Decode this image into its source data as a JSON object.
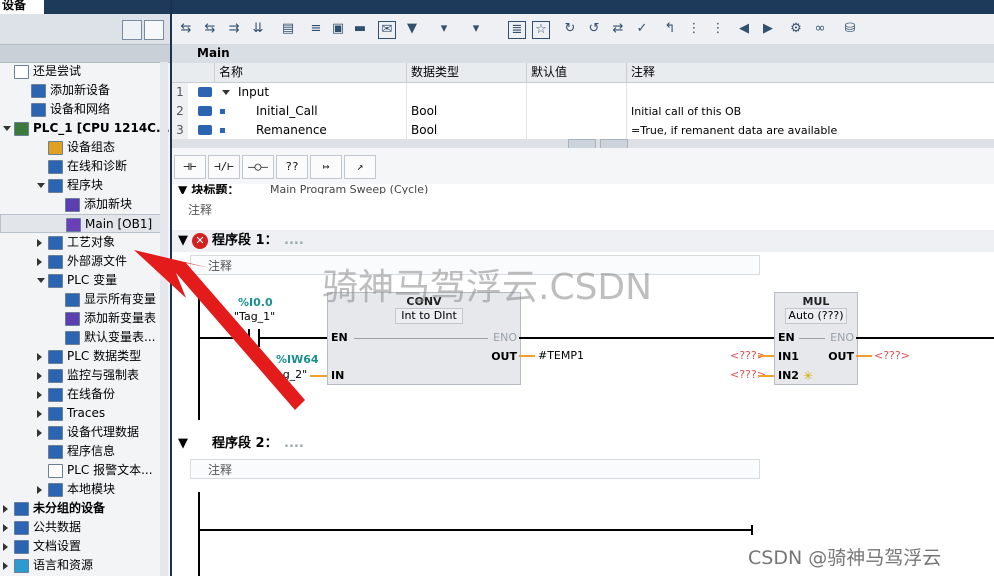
{
  "left_panel": {
    "title": "设备",
    "tree": [
      {
        "label": "还是尝试",
        "indent": 0,
        "arrow": "",
        "icon": "project-icon",
        "bold": false
      },
      {
        "label": "添加新设备",
        "indent": 1,
        "arrow": "",
        "icon": "add-device-icon",
        "bold": false
      },
      {
        "label": "设备和网络",
        "indent": 1,
        "arrow": "",
        "icon": "network-icon",
        "bold": false
      },
      {
        "label": "PLC_1 [CPU 1214C...",
        "indent": 0,
        "arrow": "down",
        "icon": "plc-icon",
        "bold": true
      },
      {
        "label": "设备组态",
        "indent": 2,
        "arrow": "",
        "icon": "device-config-icon",
        "bold": false
      },
      {
        "label": "在线和诊断",
        "indent": 2,
        "arrow": "",
        "icon": "diagnostics-icon",
        "bold": false
      },
      {
        "label": "程序块",
        "indent": 2,
        "arrow": "down",
        "icon": "folder-icon",
        "bold": false
      },
      {
        "label": "添加新块",
        "indent": 3,
        "arrow": "",
        "icon": "add-block-icon",
        "bold": false
      },
      {
        "label": "Main [OB1]",
        "indent": 3,
        "arrow": "",
        "icon": "ob-block-icon",
        "bold": false,
        "selected": true
      },
      {
        "label": "工艺对象",
        "indent": 2,
        "arrow": "right",
        "icon": "folder-icon",
        "bold": false
      },
      {
        "label": "外部源文件",
        "indent": 2,
        "arrow": "right",
        "icon": "folder-icon",
        "bold": false
      },
      {
        "label": "PLC 变量",
        "indent": 2,
        "arrow": "down",
        "icon": "folder-icon",
        "bold": false
      },
      {
        "label": "显示所有变量",
        "indent": 3,
        "arrow": "",
        "icon": "tag-table-icon",
        "bold": false
      },
      {
        "label": "添加新变量表",
        "indent": 3,
        "arrow": "",
        "icon": "add-tag-table-icon",
        "bold": false
      },
      {
        "label": "默认变量表...",
        "indent": 3,
        "arrow": "",
        "icon": "tag-table-icon",
        "bold": false
      },
      {
        "label": "PLC 数据类型",
        "indent": 2,
        "arrow": "right",
        "icon": "folder-icon",
        "bold": false
      },
      {
        "label": "监控与强制表",
        "indent": 2,
        "arrow": "right",
        "icon": "folder-icon",
        "bold": false
      },
      {
        "label": "在线备份",
        "indent": 2,
        "arrow": "right",
        "icon": "folder-icon",
        "bold": false
      },
      {
        "label": "Traces",
        "indent": 2,
        "arrow": "right",
        "icon": "folder-icon",
        "bold": false
      },
      {
        "label": "设备代理数据",
        "indent": 2,
        "arrow": "right",
        "icon": "folder-icon",
        "bold": false
      },
      {
        "label": "程序信息",
        "indent": 2,
        "arrow": "",
        "icon": "program-info-icon",
        "bold": false
      },
      {
        "label": "PLC 报警文本...",
        "indent": 2,
        "arrow": "",
        "icon": "alarm-text-icon",
        "bold": false
      },
      {
        "label": "本地模块",
        "indent": 2,
        "arrow": "right",
        "icon": "folder-icon",
        "bold": false
      },
      {
        "label": "未分组的设备",
        "indent": 0,
        "arrow": "right",
        "icon": "folder-icon",
        "bold": true
      },
      {
        "label": "公共数据",
        "indent": 0,
        "arrow": "right",
        "icon": "folder-icon",
        "bold": false
      },
      {
        "label": "文档设置",
        "indent": 0,
        "arrow": "right",
        "icon": "folder-icon",
        "bold": false
      },
      {
        "label": "语言和资源",
        "indent": 0,
        "arrow": "right",
        "icon": "language-icon",
        "bold": false
      }
    ]
  },
  "block": {
    "name": "Main",
    "headers": {
      "name": "名称",
      "type": "数据类型",
      "default": "默认值",
      "comment": "注释"
    },
    "rows": [
      {
        "num": "1",
        "name": "Input",
        "type": "",
        "default": "",
        "comment": "",
        "level": 0
      },
      {
        "num": "2",
        "name": "Initial_Call",
        "type": "Bool",
        "default": "",
        "comment": "Initial call of this OB",
        "level": 1
      },
      {
        "num": "3",
        "name": "Remanence",
        "type": "Bool",
        "default": "",
        "comment": "=True, if remanent data are available",
        "level": 1
      }
    ]
  },
  "ladder_tools": [
    "⊣⊢",
    "⊣/⊢",
    "–◯–",
    "??",
    "↦",
    "↗"
  ],
  "editor": {
    "block_title_label": "块标题：",
    "block_title_text": "Main Program Sweep (Cycle)",
    "comment_label": "注释",
    "network1": {
      "label": "程序段 1：",
      "dots": "....",
      "comment": "注释",
      "contact_addr": "%I0.0",
      "contact_tag": "\"Tag_1\"",
      "conv": {
        "title": "CONV",
        "from": "Int",
        "to_word": "to",
        "to": "DInt",
        "en": "EN",
        "eno": "ENO",
        "in": "IN",
        "out": "OUT"
      },
      "in_addr": "%IW64",
      "in_tag": "\"Tag_2\"",
      "out_operand": "#TEMP1",
      "mul": {
        "title": "MUL",
        "subtitle": "Auto (???)",
        "en": "EN",
        "eno": "ENO",
        "in1": "IN1",
        "in2": "IN2",
        "out": "OUT"
      },
      "placeholder": "<???>"
    },
    "network2": {
      "label": "程序段 2：",
      "dots": "....",
      "comment": "注释"
    }
  },
  "watermarks": {
    "center": "骑神马驾浮云.CSDN",
    "corner": "CSDN @骑神马驾浮云"
  },
  "colors": {
    "title_bar": "#1e3a5a",
    "teal_operand": "#1a8f8f",
    "placeholder_red": "#e05050",
    "error": "#d42020",
    "arrow": "#e41b1b"
  }
}
